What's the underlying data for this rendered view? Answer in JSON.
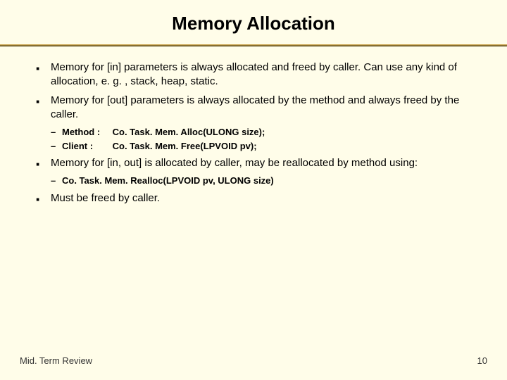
{
  "title": "Memory Allocation",
  "bullets": {
    "b1": "Memory for [in] parameters is always allocated and freed by caller. Can use any kind of allocation, e. g. , stack, heap, static.",
    "b2": "Memory for [out] parameters is always allocated by the method and always freed by the caller.",
    "b3": "Memory for [in, out] is allocated by caller, may be reallocated by method using:",
    "b4": "Must be freed by caller."
  },
  "sub1": {
    "method_label": "Method :",
    "method_sig": "Co. Task. Mem. Alloc(ULONG size);",
    "client_label": "Client :",
    "client_sig": "Co. Task. Mem. Free(LPVOID pv);"
  },
  "sub2": {
    "realloc": "Co. Task. Mem. Realloc(LPVOID pv, ULONG size)"
  },
  "footer": {
    "left": "Mid. Term Review",
    "right": "10"
  }
}
